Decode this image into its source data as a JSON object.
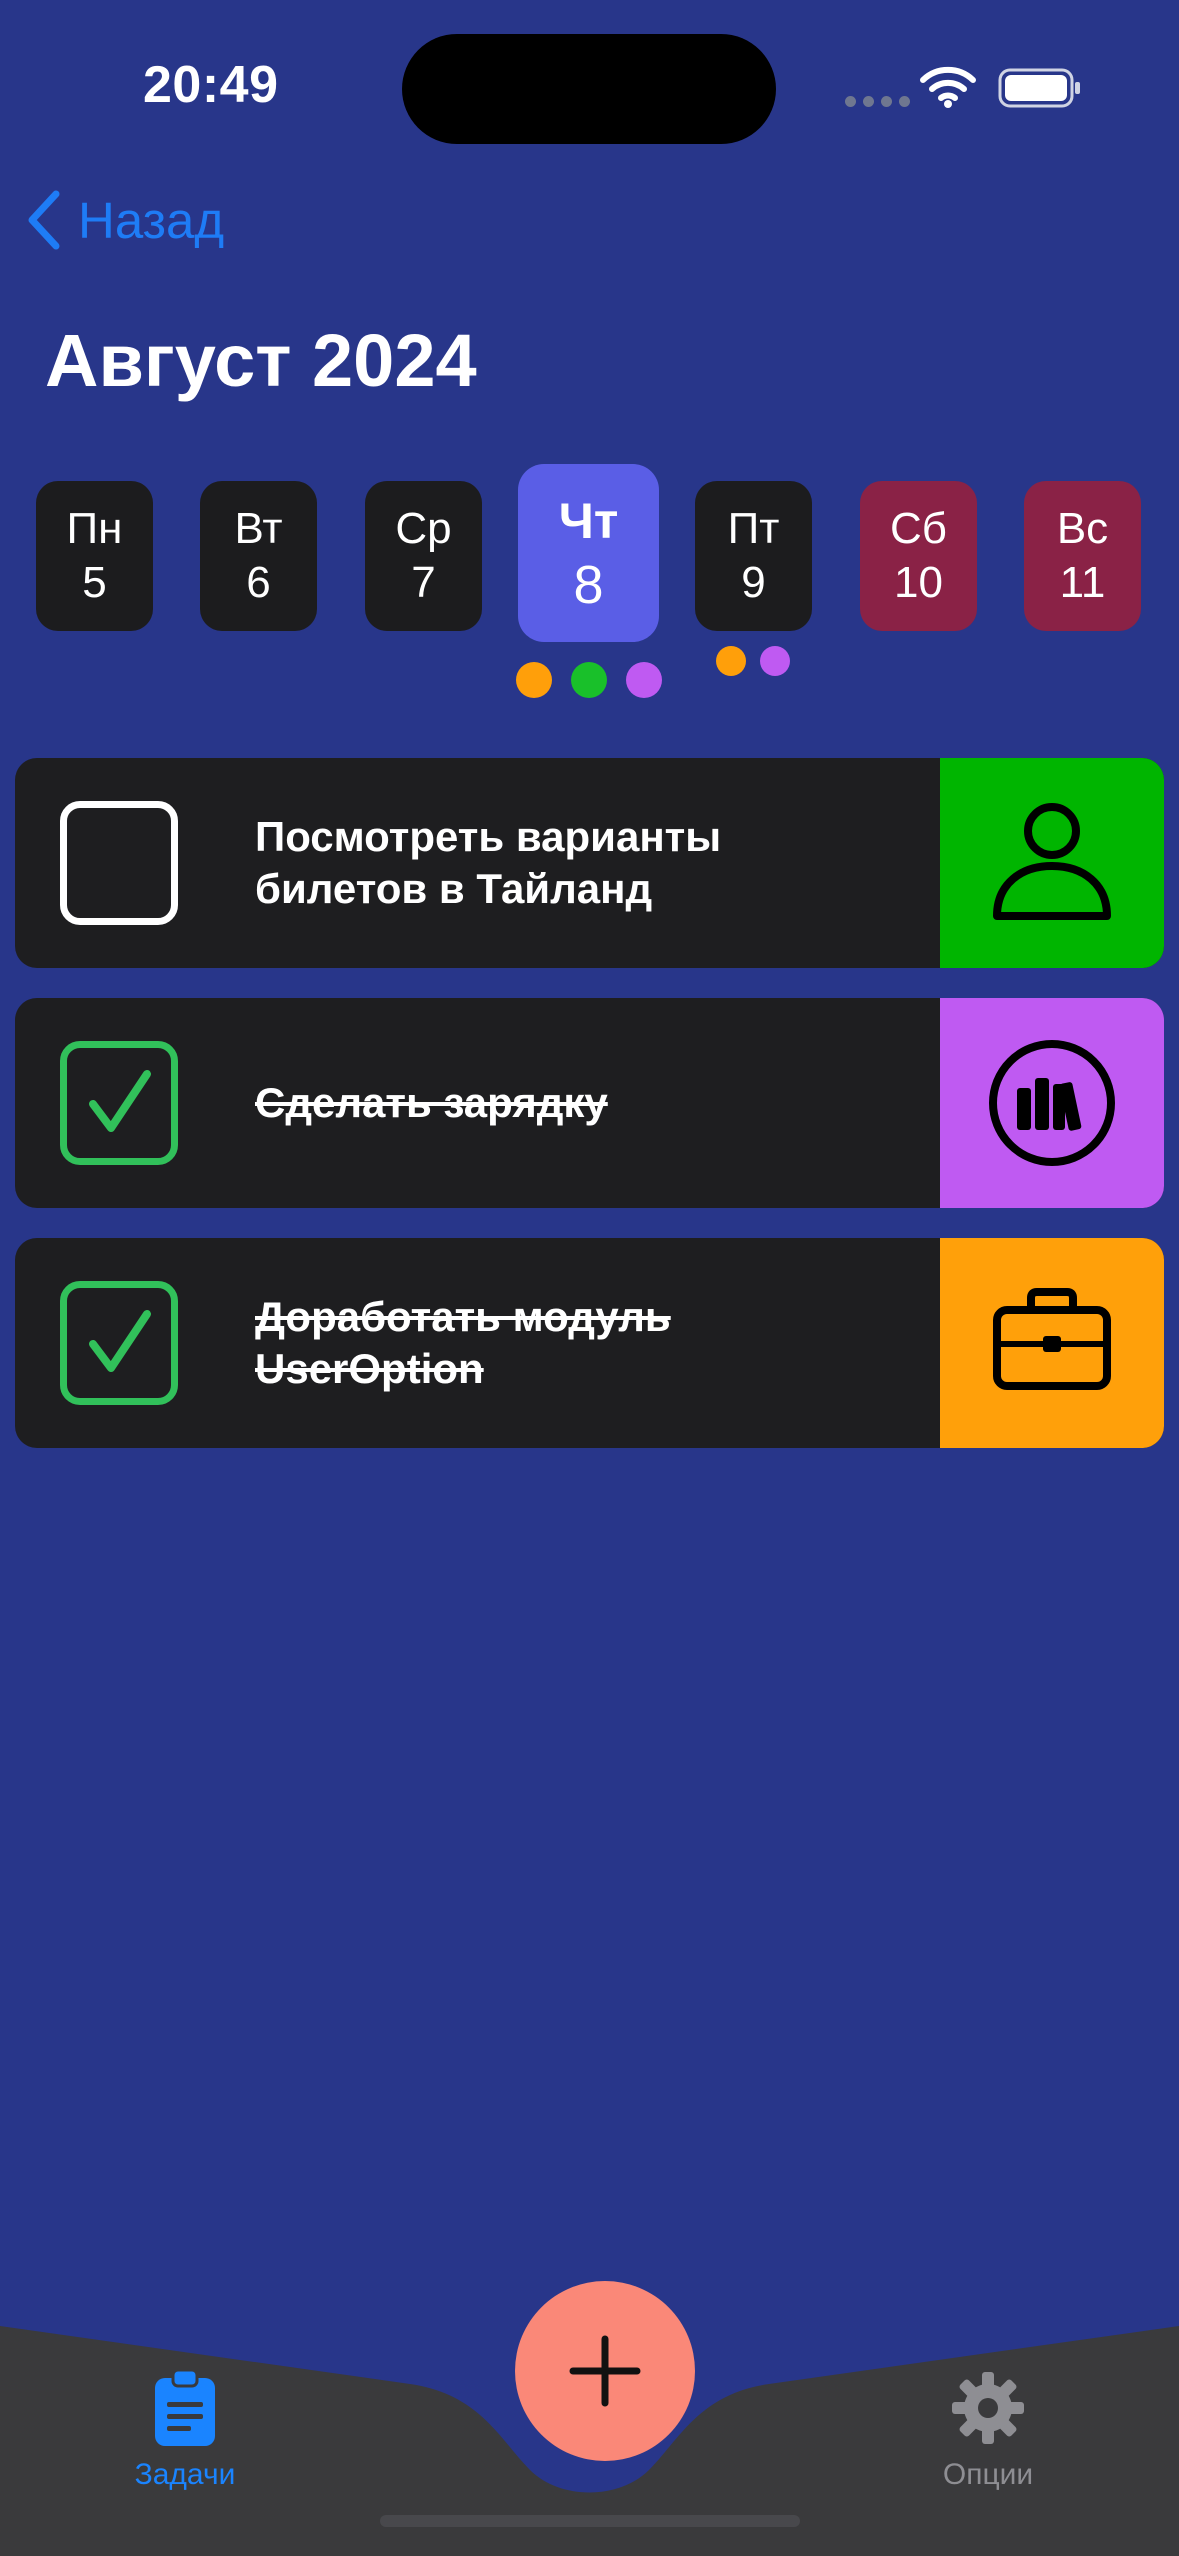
{
  "status_bar": {
    "time": "20:49"
  },
  "nav": {
    "back_label": "Назад",
    "title": "Август 2024"
  },
  "week": [
    {
      "name": "Пн",
      "num": "5"
    },
    {
      "name": "Вт",
      "num": "6"
    },
    {
      "name": "Ср",
      "num": "7"
    },
    {
      "name": "Чт",
      "num": "8"
    },
    {
      "name": "Пт",
      "num": "9"
    },
    {
      "name": "Сб",
      "num": "10"
    },
    {
      "name": "Вс",
      "num": "11"
    }
  ],
  "selected_day": "Чт 8",
  "day_markers": {
    "thu": [
      "#ff9f0a",
      "#19c02a",
      "#bf5af2"
    ],
    "fri": [
      "#ff9f0a",
      "#bf5af2"
    ]
  },
  "tasks": [
    {
      "text": "Посмотреть варианты билетов в Тайланд",
      "done": false,
      "category_icon": "person-icon",
      "category_color": "#00b500"
    },
    {
      "text": "Сделать зарядку",
      "done": true,
      "category_icon": "books-icon",
      "category_color": "#bf5af2"
    },
    {
      "text": "Доработать модуль UserOption",
      "done": true,
      "category_icon": "briefcase-icon",
      "category_color": "#ffa00a"
    }
  ],
  "tabbar": {
    "tasks_label": "Задачи",
    "options_label": "Опции",
    "active_color": "#1a84ff",
    "inactive_color": "#8e8e93"
  }
}
